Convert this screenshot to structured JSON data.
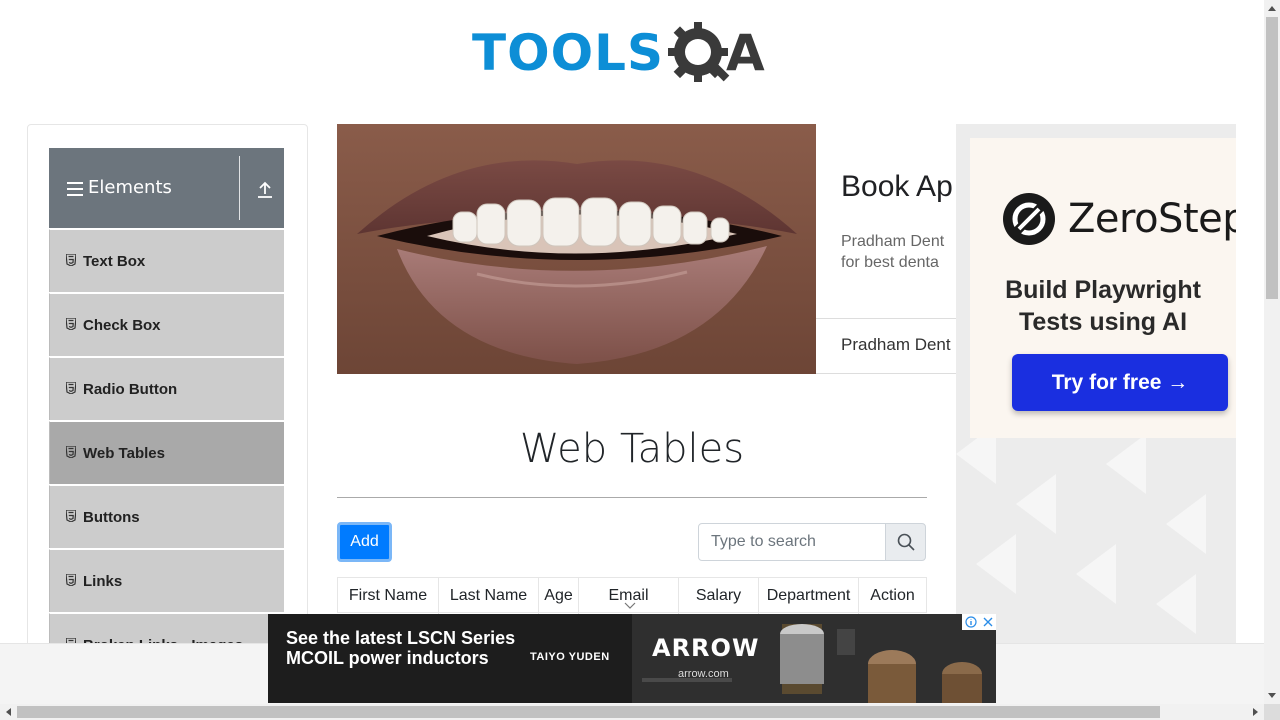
{
  "header": {
    "logo_text": "TOOLS",
    "logo_suffix": "A"
  },
  "sidebar": {
    "group_title": "Elements",
    "items": [
      {
        "label": "Text Box",
        "active": false
      },
      {
        "label": "Check Box",
        "active": false
      },
      {
        "label": "Radio Button",
        "active": false
      },
      {
        "label": "Web Tables",
        "active": true
      },
      {
        "label": "Buttons",
        "active": false
      },
      {
        "label": "Links",
        "active": false
      },
      {
        "label": "Broken Links - Images",
        "active": false
      }
    ]
  },
  "banner": {
    "ad_title": "Book Ap",
    "ad_desc_line1": "Pradham Dent",
    "ad_desc_line2": "for best denta",
    "ad_name": "Pradham Dent"
  },
  "right_ad": {
    "brand": "ZeroStep",
    "tagline": "Build Playwright Tests using AI",
    "button": "Try for free →"
  },
  "main": {
    "title": "Web Tables",
    "add_button": "Add",
    "search_placeholder": "Type to search",
    "columns": [
      "First Name",
      "Last Name",
      "Age",
      "Email",
      "Salary",
      "Department",
      "Action"
    ]
  },
  "bottom_ad": {
    "headline": "See the latest LSCN Series MCOIL power inductors",
    "sponsor": "TAIYO YUDEN",
    "logo": "ARROW",
    "url": "arrow.com"
  }
}
